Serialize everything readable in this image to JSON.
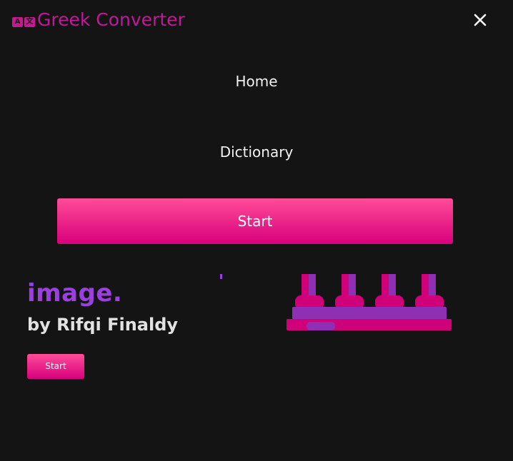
{
  "app": {
    "title": "Greek Converter",
    "logo_glyph_left": "A",
    "logo_glyph_right": "文",
    "accent_color": "#c2189a"
  },
  "menu": {
    "items": [
      {
        "label": "Home"
      },
      {
        "label": "Dictionary"
      }
    ],
    "start_label": "Start",
    "close_icon": "close-icon"
  },
  "hero": {
    "heading_visible": "image.",
    "byline": "by Rifqi Finaldy",
    "start_label": "Start",
    "illustration_icon": "abacus-icon"
  },
  "colors": {
    "background": "#141414",
    "button_gradient_top": "#ff4c98",
    "button_gradient_bottom": "#d8007c",
    "heading": "#9b3fe0"
  }
}
